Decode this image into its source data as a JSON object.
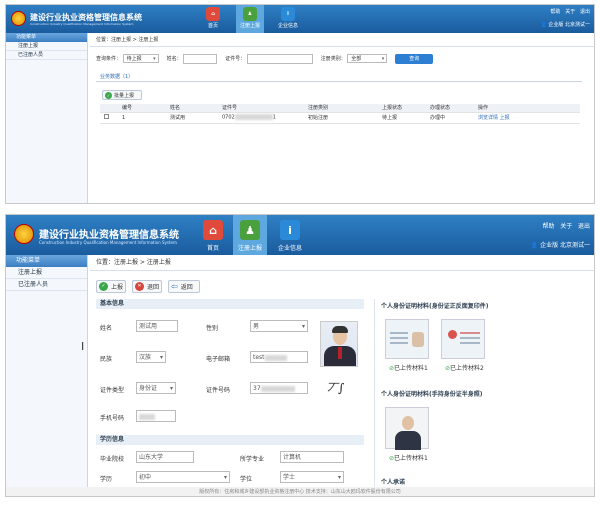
{
  "app": {
    "title": "建设行业执业资格管理信息系统",
    "subtitle": "Construction Industry Qualification Management Information System"
  },
  "nav": [
    {
      "label": "首页",
      "icon": "home-icon",
      "color": "#e04a3a"
    },
    {
      "label": "注册上报",
      "icon": "user-upload-icon",
      "color": "#4aa03c"
    },
    {
      "label": "企业信息",
      "icon": "info-icon",
      "color": "#2a8ad8"
    }
  ],
  "topright": {
    "help": "帮助",
    "about": "关于",
    "logout": "退出",
    "user": "企业版  北京测试一"
  },
  "sidebar": {
    "header": "功能菜单",
    "items": [
      "注册上报",
      "已注册人员"
    ]
  },
  "list_screen": {
    "breadcrumb": "位置：注册上报 > 注册上报",
    "filter": {
      "status_label": "查询条件：",
      "status_value": "待上报",
      "name_label": "姓名：",
      "id_label": "证件号：",
      "type_label": "注册类别：",
      "type_value": "全部",
      "query_button": "查询"
    },
    "tab": "业务数据（1）",
    "batch_button": "批量上报",
    "columns": [
      "",
      "编号",
      "姓名",
      "证件号",
      "注册类别",
      "上报状态",
      "办理状态",
      "操作"
    ],
    "rows": [
      {
        "no": "1",
        "name": "测试用",
        "id_prefix": "0702",
        "id_suffix": "1",
        "type": "初始注册",
        "report": "待上报",
        "process": "办理中",
        "actions": "浏览详情 上报"
      }
    ]
  },
  "detail_screen": {
    "breadcrumb": "位置：注册上报 > 注册上报",
    "toolbar": {
      "upload": "上报",
      "back": "退回",
      "return": "返回"
    },
    "basic_section": "基本信息",
    "fields": {
      "name_label": "姓名",
      "name_value": "测试用",
      "gender_label": "性别",
      "gender_value": "男",
      "ethnic_label": "民族",
      "ethnic_value": "汉族",
      "email_label": "电子邮箱",
      "email_value": "test",
      "idtype_label": "证件类型",
      "idtype_value": "身份证",
      "idno_label": "证件号码",
      "idno_value": "37",
      "phone_label": "手机号码"
    },
    "edu_section": "学历信息",
    "edu": {
      "school_label": "毕业院校",
      "school_value": "山东大学",
      "major_label": "所学专业",
      "major_value": "计算机",
      "degree_label": "学历",
      "degree_value": "初中",
      "bachelor_label": "学位",
      "bachelor_value": "学士"
    },
    "right": {
      "id_section": "个人身份证明材料(身份证正反面复印件)",
      "id_cap1": "已上传材料1",
      "id_cap2": "已上传材料2",
      "hold_section": "个人身份证明材料(手持身份证半身照)",
      "hold_cap1": "已上传材料1",
      "bottom_section": "个人承诺"
    },
    "footer": "版权所有：住房和城乡建设部执业资格注册中心    技术支持：山东山大鸥玛软件股份有限公司"
  }
}
